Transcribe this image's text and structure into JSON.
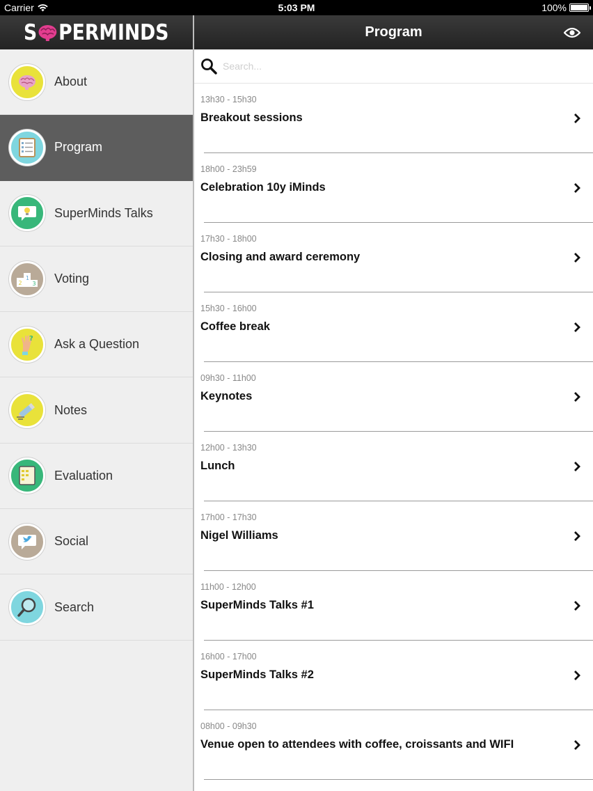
{
  "status_bar": {
    "carrier": "Carrier",
    "time": "5:03 PM",
    "battery": "100%"
  },
  "sidebar": {
    "logo_left": "S",
    "logo_right": "PERMINDS",
    "items": [
      {
        "label": "About",
        "icon": "brain-icon",
        "color": "#e9e23a",
        "active": false
      },
      {
        "label": "Program",
        "icon": "program-list-icon",
        "color": "#7fd6df",
        "active": true
      },
      {
        "label": "SuperMinds Talks",
        "icon": "lightbulb-speech-icon",
        "color": "#38b77a",
        "active": false
      },
      {
        "label": "Voting",
        "icon": "podium-icon",
        "color": "#b9aa98",
        "active": false
      },
      {
        "label": "Ask a Question",
        "icon": "raised-hand-icon",
        "color": "#e9e23a",
        "active": false
      },
      {
        "label": "Notes",
        "icon": "pencil-icon",
        "color": "#e9e23a",
        "active": false
      },
      {
        "label": "Evaluation",
        "icon": "clipboard-icon",
        "color": "#38b77a",
        "active": false
      },
      {
        "label": "Social",
        "icon": "twitter-bird-icon",
        "color": "#b9aa98",
        "active": false
      },
      {
        "label": "Search",
        "icon": "magnifier-icon",
        "color": "#7fd6df",
        "active": false
      }
    ]
  },
  "header": {
    "title": "Program",
    "right_icon": "eye-icon"
  },
  "search": {
    "placeholder": "Search..."
  },
  "program": [
    {
      "time": "13h30 - 15h30",
      "title": "Breakout sessions"
    },
    {
      "time": "18h00 - 23h59",
      "title": "Celebration 10y iMinds"
    },
    {
      "time": "17h30 - 18h00",
      "title": "Closing and award ceremony"
    },
    {
      "time": "15h30 - 16h00",
      "title": "Coffee break"
    },
    {
      "time": "09h30 - 11h00",
      "title": "Keynotes"
    },
    {
      "time": "12h00 - 13h30",
      "title": "Lunch"
    },
    {
      "time": "17h00 - 17h30",
      "title": "Nigel Williams"
    },
    {
      "time": "11h00 - 12h00",
      "title": "SuperMinds Talks #1"
    },
    {
      "time": "16h00 - 17h00",
      "title": "SuperMinds Talks #2"
    },
    {
      "time": "08h00 - 09h30",
      "title": "Venue open to attendees with coffee, croissants and WIFI"
    }
  ],
  "colors": {
    "brand_pink": "#e23d8f",
    "active_nav": "#5d5d5d"
  }
}
